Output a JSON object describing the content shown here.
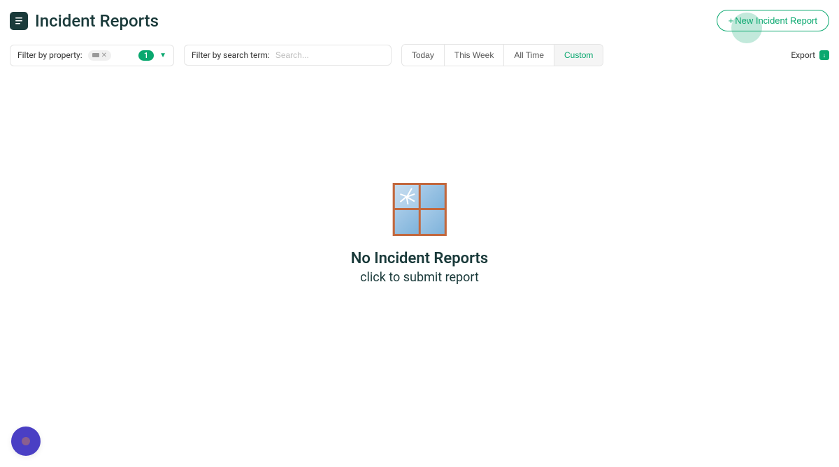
{
  "header": {
    "title": "Incident Reports",
    "new_report_label": "New Incident Report"
  },
  "filters": {
    "property_label": "Filter by property:",
    "property_count": "1",
    "search_label": "Filter by search term:",
    "search_placeholder": "Search...",
    "time_options": {
      "today": "Today",
      "this_week": "This Week",
      "all_time": "All Time",
      "custom": "Custom"
    },
    "active_time_filter": "custom"
  },
  "export": {
    "label": "Export"
  },
  "empty_state": {
    "title": "No Incident Reports",
    "subtitle": "click to submit report"
  }
}
